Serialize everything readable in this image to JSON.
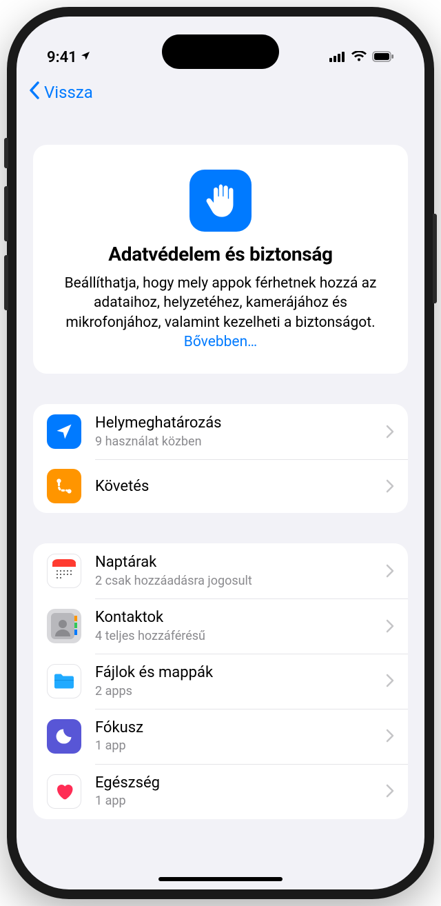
{
  "status": {
    "time": "9:41"
  },
  "nav": {
    "back_label": "Vissza"
  },
  "hero": {
    "title": "Adatvédelem és biztonság",
    "description": "Beállíthatja, hogy mely appok férhetnek hozzá az adataihoz, helyzetéhez, kamerájához és mikrofonjához, valamint kezelheti a biztonságot. ",
    "link": "Bővebben…"
  },
  "group1": [
    {
      "title": "Helymeghatározás",
      "sub": "9 használat közben",
      "icon": "location",
      "color": "#007aff"
    },
    {
      "title": "Követés",
      "sub": "",
      "icon": "tracking",
      "color": "#ff9500"
    }
  ],
  "group2": [
    {
      "title": "Naptárak",
      "sub": "2 csak hozzáadásra jogosult",
      "icon": "calendar",
      "color": "#ffffff"
    },
    {
      "title": "Kontaktok",
      "sub": "4 teljes hozzáférésű",
      "icon": "contacts",
      "color": "#e0e0e2"
    },
    {
      "title": "Fájlok és mappák",
      "sub": "2 apps",
      "icon": "files",
      "color": "#ffffff"
    },
    {
      "title": "Fókusz",
      "sub": "1 app",
      "icon": "focus",
      "color": "#5856d6"
    },
    {
      "title": "Egészség",
      "sub": "1 app",
      "icon": "health",
      "color": "#ffffff"
    }
  ]
}
